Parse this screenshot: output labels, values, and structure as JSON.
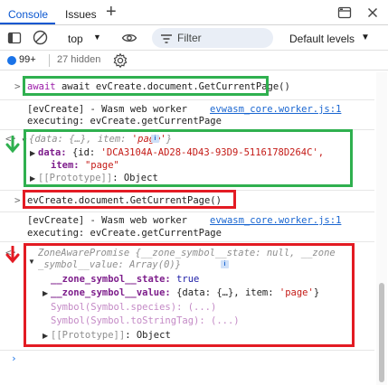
{
  "tabs": {
    "console": "Console",
    "issues": "Issues",
    "add": "+"
  },
  "toolbar": {
    "context": "top",
    "filter_placeholder": "Filter",
    "levels": "Default levels"
  },
  "status": {
    "messages": "99+",
    "hidden": "27 hidden"
  },
  "console": {
    "cmd1": "await evCreate.document.GetCurrentPage()",
    "log1": "[evCreate] - Wasm web worker",
    "log1_src": "evwasm_core.worker.js:1",
    "log2": "executing: evCreate.getCurrentPage",
    "res1_preview_a": "{data: {…}, item: ",
    "res1_preview_b": "'page'",
    "res1_preview_c": "}",
    "res1_data_key": "data:",
    "res1_data_val_a": "{id: ",
    "res1_data_val_b": "'DCA3104A-AD28-4D43-93D9-5116178D264C',",
    "res1_item_key": "item:",
    "res1_item_val": "\"page\"",
    "res1_proto": "[[Prototype]]",
    "res1_proto_val": ": Object",
    "cmd2": "evCreate.document.GetCurrentPage()",
    "log3": "[evCreate] - Wasm web worker",
    "log3_src": "evwasm_core.worker.js:1",
    "log4": "executing: evCreate.getCurrentPage",
    "res2_line1": "ZoneAwarePromise {__zone_symbol__state: null, __zone",
    "res2_line2": "_symbol__value: Array(0)}",
    "res2_state_key": "__zone_symbol__state:",
    "res2_state_val": "true",
    "res2_value_key": "__zone_symbol__value:",
    "res2_value_val_a": "{data: {…}, item: ",
    "res2_value_val_b": "'page'",
    "res2_value_val_c": "}",
    "res2_species": "Symbol(Symbol.species): (...)",
    "res2_tostring": "Symbol(Symbol.toStringTag): (...)",
    "res2_proto": "[[Prototype]]",
    "res2_proto_val": ": Object",
    "info_icon": "i"
  },
  "colors": {
    "accent": "#0b57d0",
    "green_box": "#2fb04f",
    "red_box": "#e31b23"
  },
  "icons": [
    "dock-icon",
    "close-icon",
    "sidebar-toggle-icon",
    "clear-console-icon",
    "eye-icon",
    "filter-icon",
    "settings-gear-icon"
  ]
}
